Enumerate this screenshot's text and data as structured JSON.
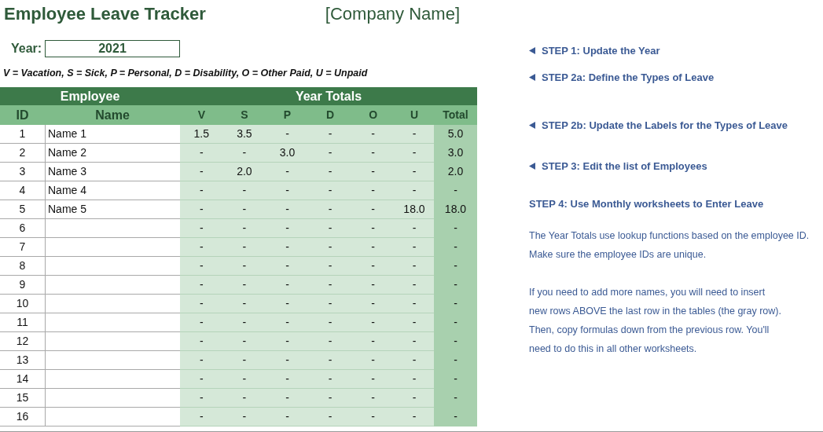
{
  "title": "Employee Leave Tracker",
  "company": "[Company Name]",
  "year": {
    "label": "Year:",
    "value": "2021"
  },
  "legend": "V = Vacation,  S = Sick, P = Personal, D = Disability, O = Other Paid, U = Unpaid",
  "table": {
    "groups": [
      "Employee",
      "Year Totals"
    ],
    "columns": [
      "ID",
      "Name",
      "V",
      "S",
      "P",
      "D",
      "O",
      "U",
      "Total"
    ],
    "rows": [
      {
        "id": "1",
        "name": "Name 1",
        "values": [
          "1.5",
          "3.5",
          "-",
          "-",
          "-",
          "-",
          "5.0"
        ]
      },
      {
        "id": "2",
        "name": "Name 2",
        "values": [
          "-",
          "-",
          "3.0",
          "-",
          "-",
          "-",
          "3.0"
        ]
      },
      {
        "id": "3",
        "name": "Name 3",
        "values": [
          "-",
          "2.0",
          "-",
          "-",
          "-",
          "-",
          "2.0"
        ]
      },
      {
        "id": "4",
        "name": "Name 4",
        "values": [
          "-",
          "-",
          "-",
          "-",
          "-",
          "-",
          "-"
        ]
      },
      {
        "id": "5",
        "name": "Name 5",
        "values": [
          "-",
          "-",
          "-",
          "-",
          "-",
          "18.0",
          "18.0"
        ]
      },
      {
        "id": "6",
        "values": [
          "-",
          "-",
          "-",
          "-",
          "-",
          "-",
          "-"
        ]
      },
      {
        "id": "7",
        "values": [
          "-",
          "-",
          "-",
          "-",
          "-",
          "-",
          "-"
        ]
      },
      {
        "id": "8",
        "values": [
          "-",
          "-",
          "-",
          "-",
          "-",
          "-",
          "-"
        ]
      },
      {
        "id": "9",
        "values": [
          "-",
          "-",
          "-",
          "-",
          "-",
          "-",
          "-"
        ]
      },
      {
        "id": "10",
        "values": [
          "-",
          "-",
          "-",
          "-",
          "-",
          "-",
          "-"
        ]
      },
      {
        "id": "11",
        "values": [
          "-",
          "-",
          "-",
          "-",
          "-",
          "-",
          "-"
        ]
      },
      {
        "id": "12",
        "values": [
          "-",
          "-",
          "-",
          "-",
          "-",
          "-",
          "-"
        ]
      },
      {
        "id": "13",
        "values": [
          "-",
          "-",
          "-",
          "-",
          "-",
          "-",
          "-"
        ]
      },
      {
        "id": "14",
        "values": [
          "-",
          "-",
          "-",
          "-",
          "-",
          "-",
          "-"
        ]
      },
      {
        "id": "15",
        "values": [
          "-",
          "-",
          "-",
          "-",
          "-",
          "-",
          "-"
        ]
      },
      {
        "id": "16",
        "values": [
          "-",
          "-",
          "-",
          "-",
          "-",
          "-",
          "-"
        ]
      }
    ]
  },
  "steps": [
    {
      "text": "STEP 1: Update the Year",
      "arrow": true
    },
    {
      "text": "STEP 2a: Define the Types of Leave",
      "arrow": true
    },
    {
      "text": "STEP 2b: Update the Labels for the Types of Leave",
      "arrow": true
    },
    {
      "text": "STEP 3: Edit the list of Employees",
      "arrow": true
    },
    {
      "text": "STEP 4: Use Monthly worksheets to Enter Leave",
      "arrow": false
    }
  ],
  "notes": [
    [
      "The Year Totals use lookup functions based on the employee ID.",
      "Make sure the employee IDs are unique."
    ],
    [
      "If you need to add more names, you will need to insert",
      "new rows ABOVE the last row in the tables (the gray row).",
      "Then, copy formulas down from the previous row. You'll",
      "need to do this in all other worksheets."
    ]
  ]
}
